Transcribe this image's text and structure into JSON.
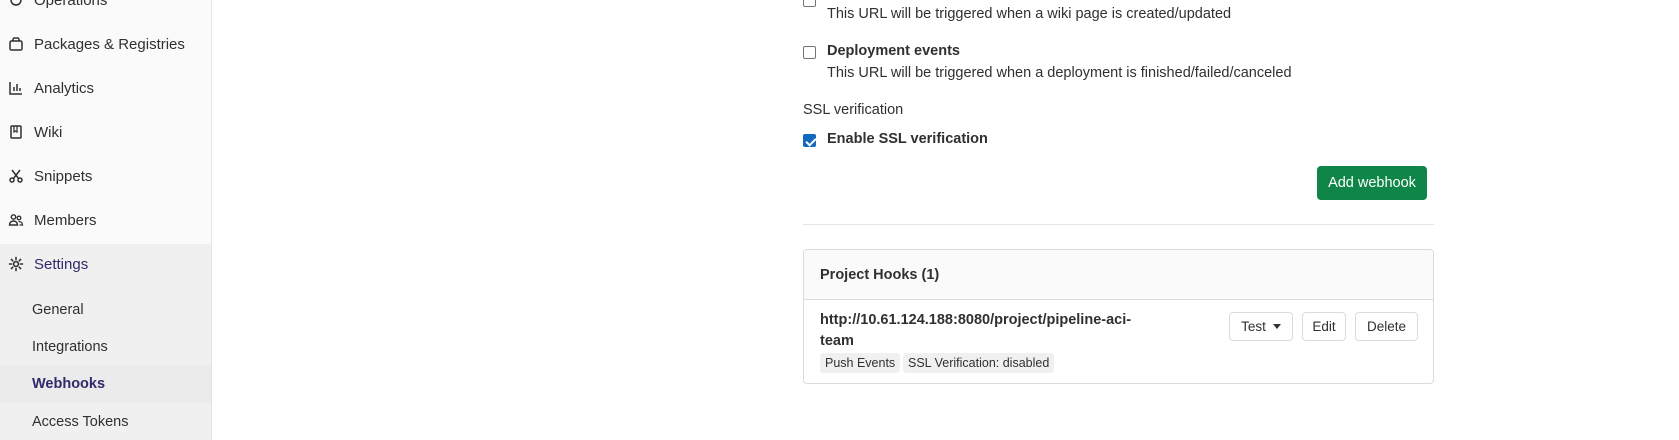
{
  "sidebar": {
    "items": [
      {
        "label": "Operations",
        "icon": "operations-icon"
      },
      {
        "label": "Packages & Registries",
        "icon": "package-icon"
      },
      {
        "label": "Analytics",
        "icon": "chart-icon"
      },
      {
        "label": "Wiki",
        "icon": "book-icon"
      },
      {
        "label": "Snippets",
        "icon": "scissors-icon"
      },
      {
        "label": "Members",
        "icon": "users-icon"
      },
      {
        "label": "Settings",
        "icon": "gear-icon"
      }
    ],
    "subitems": [
      "General",
      "Integrations",
      "Webhooks",
      "Access Tokens"
    ],
    "active_subitem": "Webhooks"
  },
  "form": {
    "wiki_desc": "This URL will be triggered when a wiki page is created/updated",
    "deployment_label": "Deployment events",
    "deployment_desc": "This URL will be triggered when a deployment is finished/failed/canceled",
    "ssl_heading": "SSL verification",
    "ssl_label": "Enable SSL verification",
    "ssl_checked": true,
    "add_button": "Add webhook"
  },
  "hooks": {
    "title": "Project Hooks (1)",
    "url_line1": "http://10.61.124.188:8080/project/pipeline-aci-",
    "url_line2": "team",
    "badges": [
      "Push Events",
      "SSL Verification: disabled"
    ],
    "test_label": "Test",
    "edit_label": "Edit",
    "delete_label": "Delete"
  },
  "colors": {
    "primary": "#108548",
    "checkbox": "#1068bf",
    "active_text": "#2f2a6b"
  }
}
